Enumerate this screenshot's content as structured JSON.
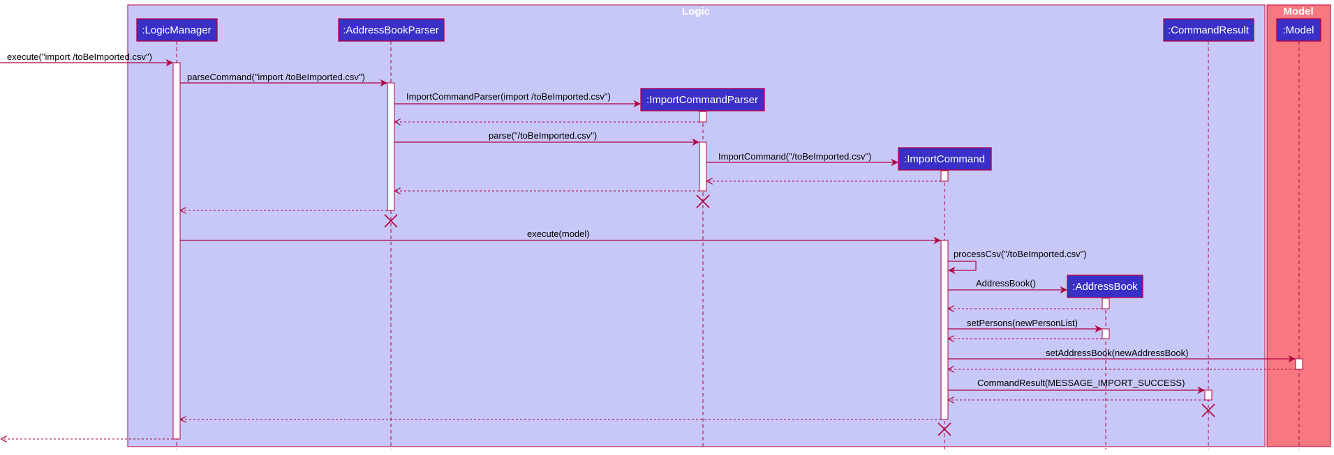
{
  "colors": {
    "logic_fill": "#c8c8f8",
    "model_fill": "#f87882",
    "border": "#c0003c",
    "participant_fill": "#3a30c8",
    "line": "#b00040"
  },
  "boxes": {
    "logic": "Logic",
    "model": "Model"
  },
  "participants": {
    "logic_manager": ":LogicManager",
    "address_book_parser": ":AddressBookParser",
    "import_command_parser": ":ImportCommandParser",
    "import_command": ":ImportCommand",
    "address_book": ":AddressBook",
    "command_result": ":CommandResult",
    "model": ":Model"
  },
  "messages": {
    "m1": "execute(\"import /toBeImported.csv\")",
    "m2": "parseCommand(\"import /toBeImported.csv\")",
    "m3": "ImportCommandParser(import /toBeImported.csv\")",
    "m4": "parse(\"/toBeImported.csv\")",
    "m5": "ImportCommand(\"/toBeImported.csv\")",
    "m6": "execute(model)",
    "m7": "processCsv(\"/toBeImported.csv\")",
    "m8": "AddressBook()",
    "m9": "setPersons(newPersonList)",
    "m10": "setAddressBook(newAddressBook)",
    "m11": "CommandResult(MESSAGE_IMPORT_SUCCESS)"
  }
}
